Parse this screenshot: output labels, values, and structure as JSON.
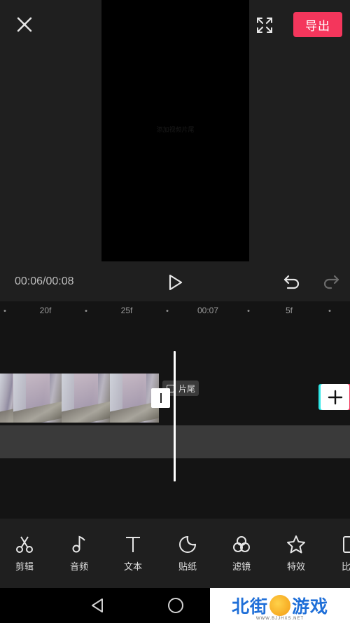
{
  "header": {
    "export_label": "导出"
  },
  "preview": {
    "caption": "添加视频片尾"
  },
  "playback": {
    "timecode": "00:06/00:08"
  },
  "ruler": {
    "labels": [
      "20f",
      "25f",
      "00:07",
      "5f"
    ]
  },
  "timeline": {
    "ending_label": "片尾"
  },
  "toolbar": {
    "items": [
      {
        "label": "剪辑",
        "icon": "scissors-icon"
      },
      {
        "label": "音频",
        "icon": "music-note-icon"
      },
      {
        "label": "文本",
        "icon": "text-icon"
      },
      {
        "label": "贴纸",
        "icon": "sticker-icon"
      },
      {
        "label": "滤镜",
        "icon": "filter-icon"
      },
      {
        "label": "特效",
        "icon": "effects-star-icon"
      },
      {
        "label": "比",
        "icon": "ratio-icon"
      }
    ]
  },
  "watermark": {
    "left": "北街",
    "right": "游戏",
    "url": "WWW.BJJHXS.NET"
  },
  "colors": {
    "accent": "#f4365c",
    "background": "#1f1f1f",
    "timeline_bg": "#141414"
  }
}
